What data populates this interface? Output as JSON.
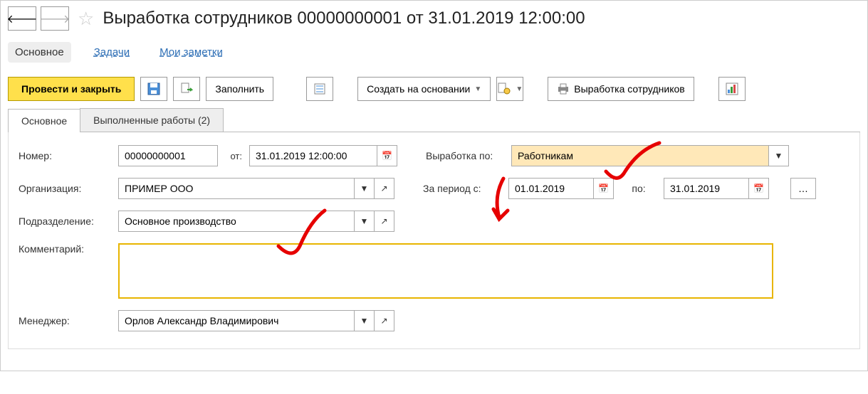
{
  "header": {
    "title": "Выработка сотрудников 00000000001 от 31.01.2019 12:00:00"
  },
  "nav": {
    "main": "Основное",
    "tasks": "Задачи",
    "notes": "Мои заметки"
  },
  "toolbar": {
    "post_close": "Провести и закрыть",
    "fill": "Заполнить",
    "create_based": "Создать на основании",
    "print_report": "Выработка сотрудников"
  },
  "tabs": {
    "main": "Основное",
    "works": "Выполненные работы (2)"
  },
  "form": {
    "number_label": "Номер:",
    "number_value": "00000000001",
    "date_prefix": "от:",
    "date_value": "31.01.2019 12:00:00",
    "by_label": "Выработка по:",
    "by_value": "Работникам",
    "org_label": "Организация:",
    "org_value": "ПРИМЕР ООО",
    "period_from_label": "За период с:",
    "period_from_value": "01.01.2019",
    "period_to_label": "по:",
    "period_to_value": "31.01.2019",
    "dept_label": "Подразделение:",
    "dept_value": "Основное производство",
    "comment_label": "Комментарий:",
    "comment_value": "",
    "manager_label": "Менеджер:",
    "manager_value": "Орлов Александр Владимирович"
  }
}
